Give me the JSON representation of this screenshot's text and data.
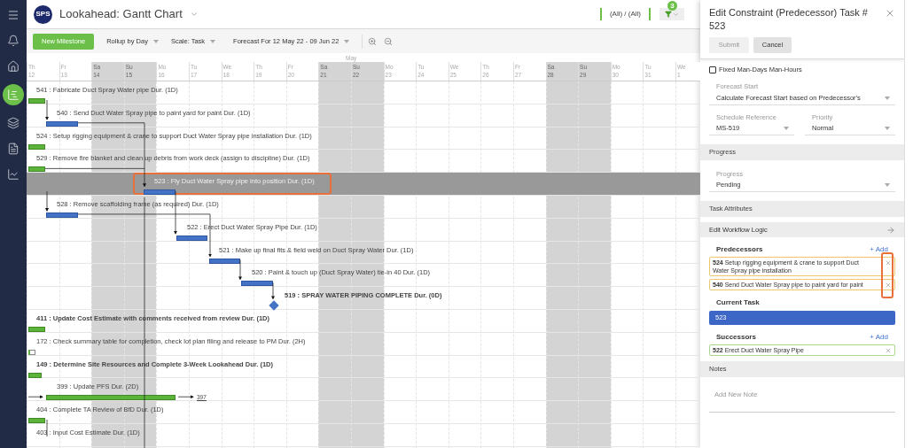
{
  "sidebar": {
    "items": [
      {
        "kind": "menu",
        "selected": false
      },
      {
        "kind": "bell",
        "selected": false
      },
      {
        "kind": "home",
        "selected": false
      },
      {
        "kind": "gantt",
        "selected": true
      },
      {
        "kind": "layers",
        "selected": false
      },
      {
        "kind": "document",
        "selected": false
      },
      {
        "kind": "chart",
        "selected": false
      }
    ]
  },
  "header": {
    "logo": "SPS",
    "title": "Lookahead: Gantt Chart",
    "filter_scope": "(All) / (All)",
    "filter_count": "3"
  },
  "toolbar": {
    "new_button": "New Milestone",
    "dropdowns": [
      "Rollup by Day",
      "Scale: Task",
      "Forecast For 12 May 22 - 09 Jun 22"
    ]
  },
  "timeline": {
    "month": "May",
    "days": [
      {
        "weekday": "Th",
        "date": "12",
        "weekend": false
      },
      {
        "weekday": "Fr",
        "date": "13",
        "weekend": false
      },
      {
        "weekday": "Sa",
        "date": "14",
        "weekend": true
      },
      {
        "weekday": "Su",
        "date": "15",
        "weekend": true
      },
      {
        "weekday": "Mo",
        "date": "16",
        "weekend": false
      },
      {
        "weekday": "Tu",
        "date": "17",
        "weekend": false
      },
      {
        "weekday": "We",
        "date": "18",
        "weekend": false
      },
      {
        "weekday": "Th",
        "date": "19",
        "weekend": false
      },
      {
        "weekday": "Fr",
        "date": "20",
        "weekend": false
      },
      {
        "weekday": "Sa",
        "date": "21",
        "weekend": true
      },
      {
        "weekday": "Su",
        "date": "22",
        "weekend": true
      },
      {
        "weekday": "Mo",
        "date": "23",
        "weekend": false
      },
      {
        "weekday": "Tu",
        "date": "24",
        "weekend": false
      },
      {
        "weekday": "We",
        "date": "25",
        "weekend": false
      },
      {
        "weekday": "Th",
        "date": "26",
        "weekend": false
      },
      {
        "weekday": "Fr",
        "date": "27",
        "weekend": false
      },
      {
        "weekday": "Sa",
        "date": "28",
        "weekend": true
      },
      {
        "weekday": "Su",
        "date": "29",
        "weekend": true
      },
      {
        "weekday": "Mo",
        "date": "30",
        "weekend": false
      },
      {
        "weekday": "Tu",
        "date": "31",
        "weekend": false
      },
      {
        "weekday": "We",
        "date": "1",
        "weekend": false
      }
    ]
  },
  "tasks": [
    {
      "label": "541 : Fabricate Duct Spray Water pipe Dur. (1D)",
      "kind": "complete",
      "bold": false,
      "selected": false
    },
    {
      "label": "540 : Send Duct Water Spray pipe to paint yard for paint Dur. (1D)",
      "kind": "planned",
      "bold": false,
      "selected": false
    },
    {
      "label": "524 : Setup rigging equipment & crane to support Duct Water Spray pipe installation Dur. (1D)",
      "kind": "complete",
      "bold": false,
      "selected": false
    },
    {
      "label": "529 : Remove fire blanket and clean up debris from work deck (assign to discipline) Dur. (1D)",
      "kind": "complete",
      "bold": false,
      "selected": false
    },
    {
      "label": "523 : Fly Duct Water Spray pipe into position Dur. (1D)",
      "kind": "planned",
      "bold": false,
      "selected": true
    },
    {
      "label": "528 : Remove scaffolding frame (as required) Dur. (1D)",
      "kind": "planned",
      "bold": false,
      "selected": false
    },
    {
      "label": "522 : Erect Duct Water Spray Pipe Dur. (1D)",
      "kind": "planned",
      "bold": false,
      "selected": false
    },
    {
      "label": "521 : Make up final fits & field weld on Duct Spray Water Dur. (1D)",
      "kind": "planned",
      "bold": false,
      "selected": false
    },
    {
      "label": "520 : Paint & touch up (Duct Spray Water) tie-in 40 Dur. (1D)",
      "kind": "planned",
      "bold": false,
      "selected": false
    },
    {
      "label": "519 : SPRAY WATER PIPING COMPLETE Dur. (0D)",
      "kind": "milestone",
      "bold": true,
      "selected": false
    },
    {
      "label": "411 : Update Cost Estimate with comments received from review Dur. (1D)",
      "kind": "complete",
      "bold": true,
      "selected": false
    },
    {
      "label": "172 : Check summary table for completion, check lot plan filing and release to PM Dur. (2H)",
      "kind": "outline",
      "bold": false,
      "selected": false
    },
    {
      "label": "149 : Determine Site Resources and Complete 3-Week Lookahead Dur. (1D)",
      "kind": "complete",
      "bold": true,
      "selected": false
    },
    {
      "label": "399 : Update PFS Dur. (2D)",
      "kind": "complete",
      "bold": false,
      "selected": false,
      "successor_link": "397"
    },
    {
      "label": "404 : Complete TA Review of BfD Dur. (1D)",
      "kind": "complete",
      "bold": false,
      "selected": false
    },
    {
      "label": "403 : Input Cost Estimate Dur. (1D)",
      "kind": "none",
      "bold": false,
      "selected": false
    }
  ],
  "panel": {
    "title": "Edit Constraint (Predecessor) Task # 523",
    "submit": {
      "label": "Submit",
      "disabled": true
    },
    "cancel": "Cancel",
    "fixed_checkbox": {
      "label": "Fixed Man-Days Man-Hours",
      "checked": false
    },
    "forecast_start": {
      "label": "Forecast Start",
      "value": "Calculate Forecast Start based on Predecessor's"
    },
    "schedule_reference": {
      "label": "Schedule Reference",
      "value": "MS-519"
    },
    "priority": {
      "label": "Priority",
      "value": "Normal"
    },
    "progress_section": "Progress",
    "progress": {
      "label": "Progress",
      "value": "Pending"
    },
    "task_attributes_section": "Task Attributes",
    "workflow_section": "Edit Workflow Logic",
    "predecessors": {
      "heading": "Predecessors",
      "add": "+ Add",
      "items": [
        {
          "id": "524",
          "text": "Setup rigging equipment & crane to support Duct Water Spray pipe installation"
        },
        {
          "id": "540",
          "text": "Send Duct Water Spray pipe to paint yard for paint"
        }
      ]
    },
    "current_task": {
      "heading": "Current Task",
      "value": "523"
    },
    "successors": {
      "heading": "Successors",
      "add": "+ Add",
      "items": [
        {
          "id": "522",
          "text": "Erect Duct Water Spray Pipe"
        }
      ]
    },
    "notes_section": "Notes",
    "notes": {
      "placeholder": "Add New Note"
    }
  }
}
